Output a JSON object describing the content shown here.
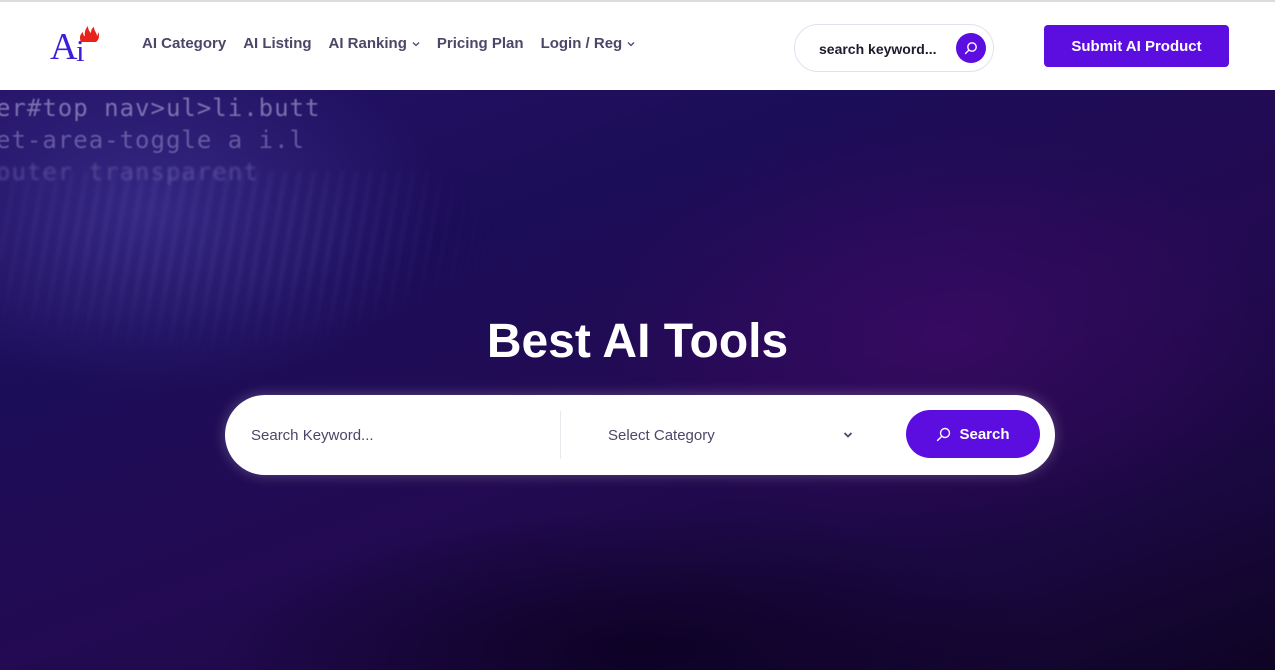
{
  "colors": {
    "accent": "#5c0ee0",
    "nav_text": "#4a4768",
    "logo_blue": "#3b1fd8",
    "logo_flame": "#e8231c"
  },
  "logo": {
    "text_a": "A",
    "text_i": "i",
    "icon": "flame-icon"
  },
  "nav": {
    "items": [
      {
        "label": "AI Category",
        "has_dropdown": false
      },
      {
        "label": "AI Listing",
        "has_dropdown": false
      },
      {
        "label": "AI Ranking",
        "has_dropdown": true
      },
      {
        "label": "Pricing Plan",
        "has_dropdown": false
      },
      {
        "label": "Login / Reg",
        "has_dropdown": true
      }
    ]
  },
  "header_search": {
    "placeholder": "search keyword...",
    "value": "",
    "icon": "search-icon"
  },
  "submit_button": {
    "label": "Submit AI Product"
  },
  "hero": {
    "background_code_lines": [
      "er#top nav>ul>li.butt",
      "et-area-toggle a i.l",
      "outer transparent"
    ],
    "title": "Best AI Tools",
    "search": {
      "keyword_placeholder": "Search Keyword...",
      "keyword_value": "",
      "category_selected": "Select Category",
      "button_label": "Search"
    }
  }
}
